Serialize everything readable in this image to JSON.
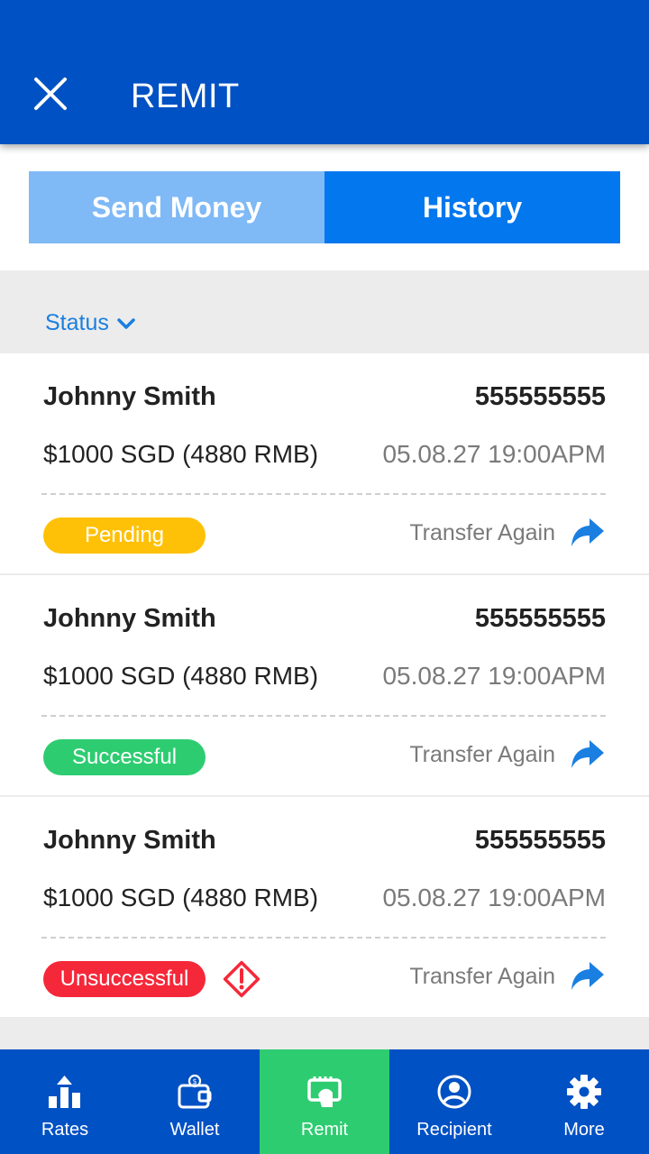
{
  "header": {
    "title": "REMIT",
    "close_icon": "close-icon"
  },
  "tabs": [
    {
      "label": "Send Money",
      "active": false
    },
    {
      "label": "History",
      "active": true
    }
  ],
  "filter": {
    "label": "Status",
    "icon": "chevron-down-icon"
  },
  "transfer_label": "Transfer Again",
  "transactions": [
    {
      "name": "Johnny Smith",
      "number": "555555555",
      "amount": "$1000 SGD (4880 RMB)",
      "date": "05.08.27 19:00APM",
      "status": "Pending",
      "status_color": "#ffc107",
      "warning": false
    },
    {
      "name": "Johnny Smith",
      "number": "555555555",
      "amount": "$1000 SGD (4880 RMB)",
      "date": "05.08.27 19:00APM",
      "status": "Successful",
      "status_color": "#2ecc71",
      "warning": false
    },
    {
      "name": "Johnny Smith",
      "number": "555555555",
      "amount": "$1000 SGD (4880 RMB)",
      "date": "05.08.27 19:00APM",
      "status": "Unsuccessful",
      "status_color": "#f5283a",
      "warning": true
    }
  ],
  "nav": [
    {
      "label": "Rates",
      "icon": "rates-icon",
      "active": false
    },
    {
      "label": "Wallet",
      "icon": "wallet-icon",
      "active": false
    },
    {
      "label": "Remit",
      "icon": "remit-icon",
      "active": true
    },
    {
      "label": "Recipient",
      "icon": "recipient-icon",
      "active": false
    },
    {
      "label": "More",
      "icon": "gear-icon",
      "active": false
    }
  ],
  "colors": {
    "primary": "#0051c4",
    "tab_active": "#0277ee",
    "tab_inactive": "#7fb9f6",
    "link": "#1a7fe0",
    "nav_active": "#2ecc71"
  }
}
